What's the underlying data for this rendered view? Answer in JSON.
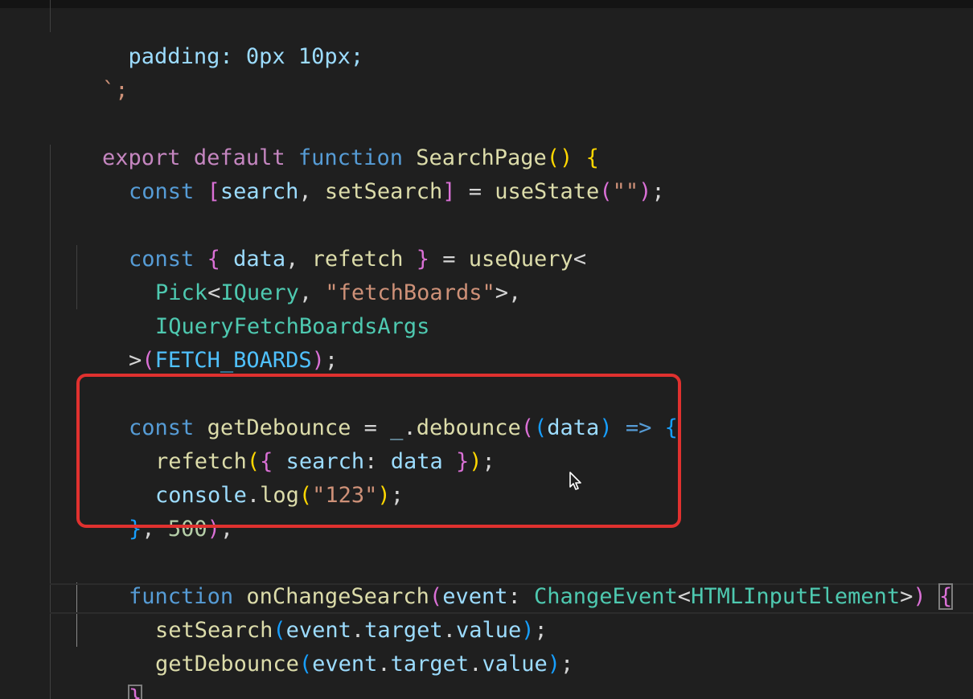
{
  "code": {
    "l1": {
      "a": "  padding: 0px 10px;"
    },
    "l2": {
      "a": "`;"
    },
    "l3": {
      "a": "export",
      "b": " ",
      "c": "default",
      "d": " ",
      "e": "function",
      "f": " ",
      "g": "SearchPage",
      "h": "(",
      "i": ")",
      "j": " ",
      "k": "{"
    },
    "l4": {
      "a": "const",
      "b": " ",
      "c": "[",
      "d": "search",
      "e": ", ",
      "f": "setSearch",
      "g": "]",
      "h": " = ",
      "i": "useState",
      "j": "(",
      "k": "\"\"",
      "l": ")",
      "m": ";"
    },
    "l5": {
      "a": "const",
      "b": " ",
      "c": "{",
      "d": " ",
      "e": "data",
      "f": ", ",
      "g": "refetch",
      "h": " ",
      "i": "}",
      "j": " = ",
      "k": "useQuery",
      "l": "<"
    },
    "l6": {
      "a": "Pick",
      "b": "<",
      "c": "IQuery",
      "d": ", ",
      "e": "\"fetchBoards\"",
      "f": ">,"
    },
    "l7": {
      "a": "IQueryFetchBoardsArgs"
    },
    "l8": {
      "a": ">",
      "b": "(",
      "c": "FETCH_BOARDS",
      "d": ")",
      "e": ";"
    },
    "l9": {
      "a": "const",
      "b": " ",
      "c": "getDebounce",
      "d": " = ",
      "e": "_",
      "f": ".",
      "g": "debounce",
      "h": "(",
      "i": "(",
      "j": "data",
      "k": ")",
      "l": " ",
      "m": "=>",
      "n": " ",
      "o": "{"
    },
    "l10": {
      "a": "refetch",
      "b": "(",
      "c": "{",
      "d": " ",
      "e": "search",
      "f": ": ",
      "g": "data",
      "h": " ",
      "i": "}",
      "j": ")",
      "k": ";"
    },
    "l11": {
      "a": "console",
      "b": ".",
      "c": "log",
      "d": "(",
      "e": "\"123\"",
      "f": ")",
      "g": ";"
    },
    "l12": {
      "a": "}",
      "b": ", ",
      "c": "500",
      "d": ")",
      "e": ";"
    },
    "l13": {
      "a": "function",
      "b": " ",
      "c": "onChangeSearch",
      "d": "(",
      "e": "event",
      "f": ": ",
      "g": "ChangeEvent",
      "h": "<",
      "i": "HTMLInputElement",
      "j": ">",
      "k": ")",
      "l": " ",
      "m": "{"
    },
    "l14": {
      "a": "setSearch",
      "b": "(",
      "c": "event",
      "d": ".",
      "e": "target",
      "f": ".",
      "g": "value",
      "h": ")",
      "i": ";"
    },
    "l15": {
      "a": "getDebounce",
      "b": "(",
      "c": "event",
      "d": ".",
      "e": "target",
      "f": ".",
      "g": "value",
      "h": ")",
      "i": ";"
    },
    "l16": {
      "a": "}"
    }
  },
  "colors": {
    "background": "#1f1f1f",
    "highlight_box": "#e0312f",
    "keyword_control": "#c586c0",
    "keyword_storage": "#569cd6",
    "function": "#dcdcaa",
    "variable": "#9cdcfe",
    "constant": "#4fc1ff",
    "type": "#4ec9b0",
    "string": "#ce9178",
    "number": "#b5cea8",
    "bracket_level1": "#ffd700",
    "bracket_level2": "#da70d6",
    "bracket_level3": "#179fff"
  },
  "icons": {
    "mouse_cursor": "mouse-pointer-icon"
  }
}
